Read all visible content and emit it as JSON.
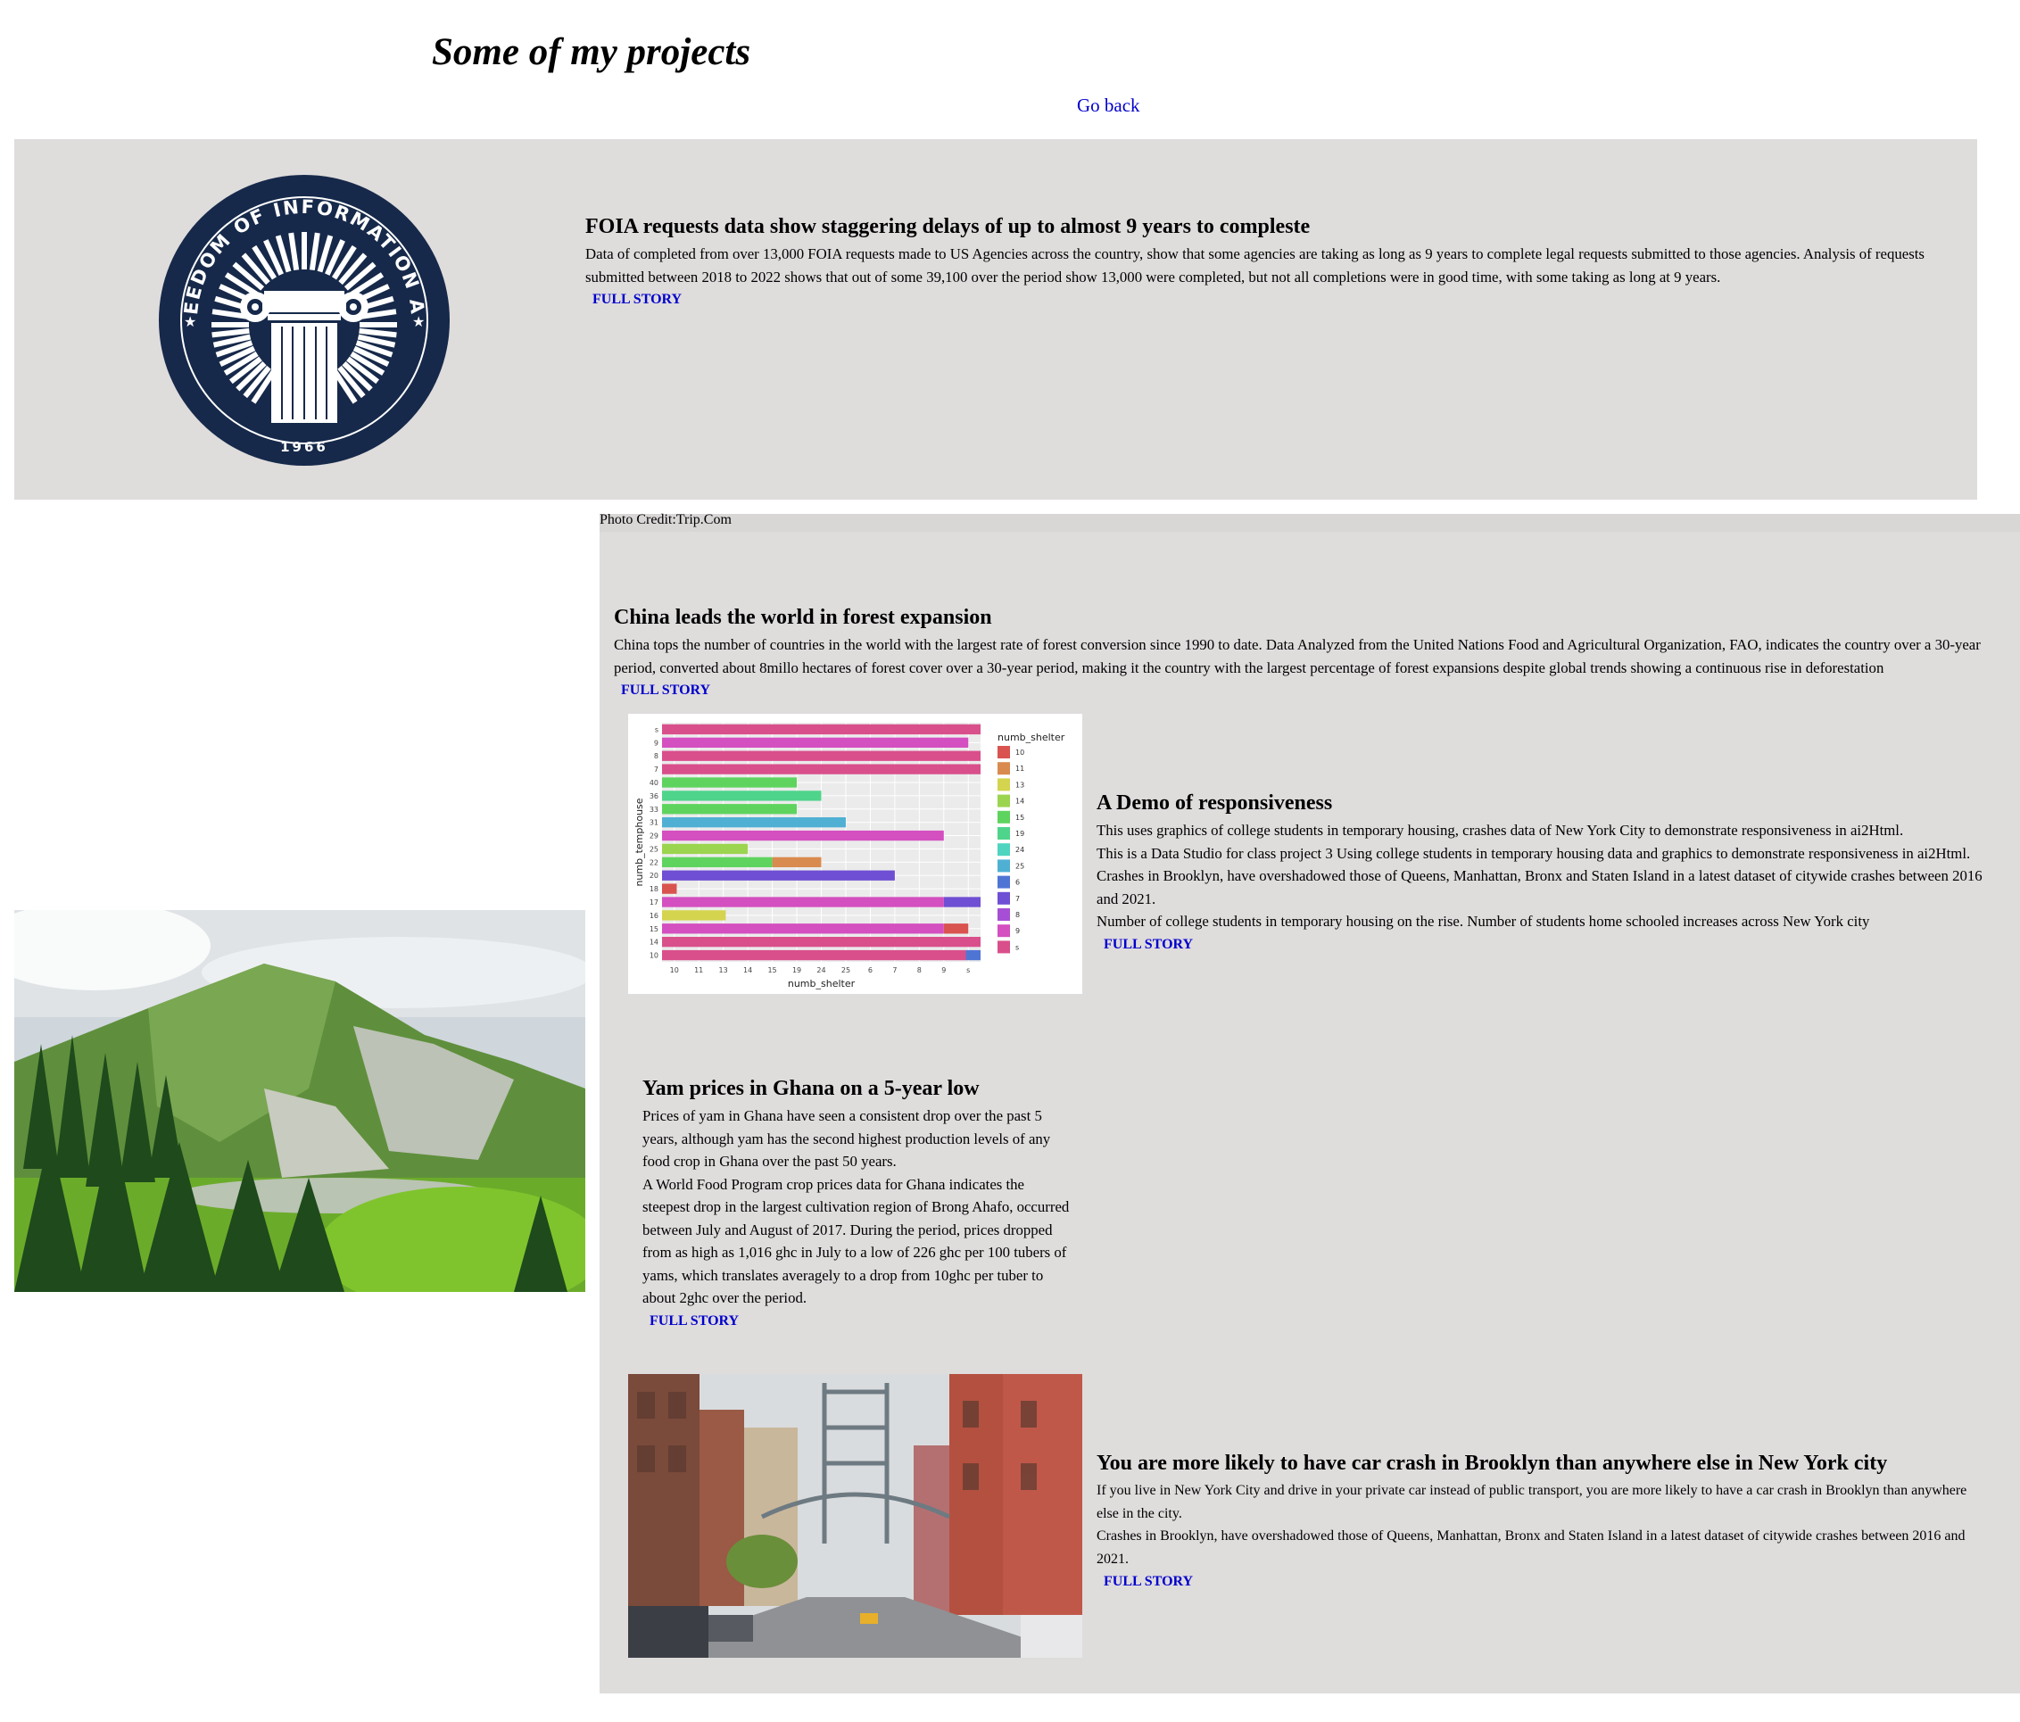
{
  "page": {
    "title": "Some of my projects",
    "go_back": "Go back"
  },
  "foia": {
    "seal_text": "FREEDOM OF INFORMATION ACT",
    "seal_year": "1966",
    "title": "FOIA requests data show staggering delays of up to almost 9 years to compleste",
    "body": "Data of completed from over 13,000 FOIA requests made to US Agencies across the country, show that some agencies are taking as long as 9 years to complete legal requests submitted to those agencies. Analysis of requests submitted between 2018 to 2022 shows that out of some 39,100 over the period show 13,000 were completed, but not all completions were in good time, with some taking as long at 9 years.",
    "link": "FULL STORY"
  },
  "photo_credit": "Photo Credit:Trip.Com",
  "china": {
    "title": "China leads the world in forest expansion",
    "body": "China tops the number of countries in the world with the largest rate of forest conversion since 1990 to date. Data Analyzed from the United Nations Food and Agricultural Organization, FAO, indicates the country over a 30-year period, converted about 8millo hectares of forest cover over a 30-year period, making it the country with the largest percentage of forest expansions despite global trends showing a continuous rise in deforestation",
    "link": "FULL STORY"
  },
  "demo": {
    "title": "A Demo of responsiveness",
    "p1": "This uses graphics of college students in temporary housing, crashes data of New York City to demonstrate responsiveness in ai2Html.",
    "p2": "This is a Data Studio for class project 3 Using college students in temporary housing data and graphics to demonstrate responsiveness in ai2Html.",
    "p3": "Crashes in Brooklyn, have overshadowed those of Queens, Manhattan, Bronx and Staten Island in a latest dataset of citywide crashes between 2016 and 2021.",
    "p4": "Number of college students in temporary housing on the rise. Number of students home schooled increases across New York city",
    "link": "FULL STORY"
  },
  "yam": {
    "title": "Yam prices in Ghana on a 5-year low",
    "p1": "Prices of yam in Ghana have seen a consistent drop over the past 5 years, although yam has the second highest production levels of any food crop in Ghana over the past 50 years.",
    "p2": "A World Food Program crop prices data for Ghana indicates the steepest drop in the largest cultivation region of Brong Ahafo, occurred between July and August of 2017. During the period, prices dropped from as high as 1,016 ghc in July to a low of 226 ghc per 100 tubers of yams, which translates averagely to a drop from 10ghc per tuber to about 2ghc over the period.",
    "link": "FULL STORY"
  },
  "brooklyn": {
    "title": "You are more likely to have car crash in Brooklyn than anywhere else in New York city",
    "p1": "If you live in New York City and drive in your private car instead of public transport, you are more likely to have a car crash in Brooklyn than anywhere else in the city.",
    "p2": "Crashes in Brooklyn, have overshadowed those of Queens, Manhattan, Bronx and Staten Island in a latest dataset of citywide crashes between 2016 and 2021.",
    "link": "FULL STORY"
  },
  "chart_data": {
    "type": "bar",
    "xlabel": "numb_shelter",
    "ylabel": "numb_temphouse",
    "legend_title": "numb_shelter",
    "legend_position": "right",
    "grid": true,
    "x_tick_labels": [
      "10",
      "11",
      "13",
      "14",
      "15",
      "19",
      "24",
      "25",
      "6",
      "7",
      "8",
      "9",
      "s"
    ],
    "legend": [
      {
        "label": "10",
        "color": "#d9534f"
      },
      {
        "label": "11",
        "color": "#d98b4f"
      },
      {
        "label": "13",
        "color": "#d4d44f"
      },
      {
        "label": "14",
        "color": "#9bd44f"
      },
      {
        "label": "15",
        "color": "#5ed45e"
      },
      {
        "label": "19",
        "color": "#4fd48b"
      },
      {
        "label": "24",
        "color": "#4fd4c0"
      },
      {
        "label": "25",
        "color": "#4fb0d4"
      },
      {
        "label": "6",
        "color": "#4f75d4"
      },
      {
        "label": "7",
        "color": "#6f4fd4"
      },
      {
        "label": "8",
        "color": "#a64fd4"
      },
      {
        "label": "9",
        "color": "#d44fc0"
      },
      {
        "label": "s",
        "color": "#d94f8b"
      }
    ],
    "categories": [
      "s",
      "9",
      "8",
      "7",
      "40",
      "36",
      "33",
      "31",
      "29",
      "25",
      "22",
      "20",
      "18",
      "17",
      "16",
      "15",
      "14",
      "10"
    ],
    "bars": [
      [
        {
          "category": "s",
          "value": 13
        }
      ],
      [
        {
          "category": "9",
          "value": 12.5
        }
      ],
      [
        {
          "category": "s",
          "value": 13
        }
      ],
      [
        {
          "category": "s",
          "value": 13
        }
      ],
      [
        {
          "category": "15",
          "value": 5.5
        }
      ],
      [
        {
          "category": "19",
          "value": 6.5
        }
      ],
      [
        {
          "category": "15",
          "value": 5.5
        }
      ],
      [
        {
          "category": "25",
          "value": 7.5
        }
      ],
      [
        {
          "category": "9",
          "value": 11.5
        }
      ],
      [
        {
          "category": "14",
          "value": 3.5
        }
      ],
      [
        {
          "category": "15",
          "value": 4.5
        },
        {
          "category": "11",
          "value": 2
        }
      ],
      [
        {
          "category": "7",
          "value": 9.5
        }
      ],
      [
        {
          "category": "10",
          "value": 0.6
        }
      ],
      [
        {
          "category": "9",
          "value": 11.5
        },
        {
          "category": "7",
          "value": 1.5
        }
      ],
      [
        {
          "category": "13",
          "value": 2.6
        }
      ],
      [
        {
          "category": "9",
          "value": 11.5
        },
        {
          "category": "10",
          "value": 1
        }
      ],
      [
        {
          "category": "s",
          "value": 13
        }
      ],
      [
        {
          "category": "s",
          "value": 12.4
        },
        {
          "category": "6",
          "value": 0.6
        }
      ]
    ],
    "xlim": [
      0,
      13
    ]
  }
}
